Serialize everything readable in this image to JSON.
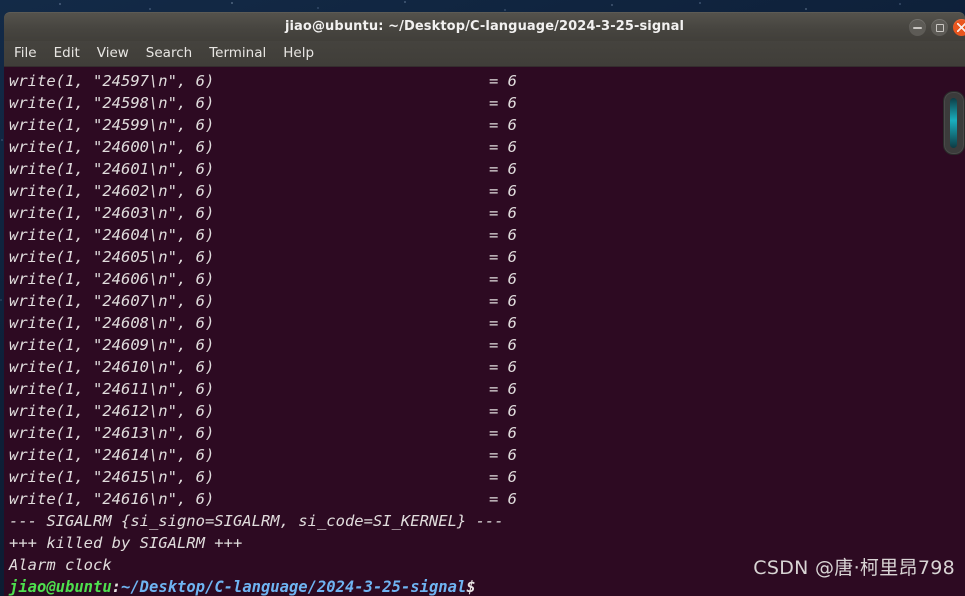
{
  "window": {
    "title": "jiao@ubuntu: ~/Desktop/C-language/2024-3-25-signal",
    "controls": {
      "minimize": "minimize",
      "maximize": "maximize",
      "close": "close"
    }
  },
  "menubar": {
    "items": [
      {
        "label": "File"
      },
      {
        "label": "Edit"
      },
      {
        "label": "View"
      },
      {
        "label": "Search"
      },
      {
        "label": "Terminal"
      },
      {
        "label": "Help"
      }
    ]
  },
  "terminal": {
    "background_color": "#2d0a22",
    "foreground_color": "#e0dcdc",
    "strace_lines": [
      {
        "call": "write(1, \"24597\\n\", 6)",
        "result": "= 6"
      },
      {
        "call": "write(1, \"24598\\n\", 6)",
        "result": "= 6"
      },
      {
        "call": "write(1, \"24599\\n\", 6)",
        "result": "= 6"
      },
      {
        "call": "write(1, \"24600\\n\", 6)",
        "result": "= 6"
      },
      {
        "call": "write(1, \"24601\\n\", 6)",
        "result": "= 6"
      },
      {
        "call": "write(1, \"24602\\n\", 6)",
        "result": "= 6"
      },
      {
        "call": "write(1, \"24603\\n\", 6)",
        "result": "= 6"
      },
      {
        "call": "write(1, \"24604\\n\", 6)",
        "result": "= 6"
      },
      {
        "call": "write(1, \"24605\\n\", 6)",
        "result": "= 6"
      },
      {
        "call": "write(1, \"24606\\n\", 6)",
        "result": "= 6"
      },
      {
        "call": "write(1, \"24607\\n\", 6)",
        "result": "= 6"
      },
      {
        "call": "write(1, \"24608\\n\", 6)",
        "result": "= 6"
      },
      {
        "call": "write(1, \"24609\\n\", 6)",
        "result": "= 6"
      },
      {
        "call": "write(1, \"24610\\n\", 6)",
        "result": "= 6"
      },
      {
        "call": "write(1, \"24611\\n\", 6)",
        "result": "= 6"
      },
      {
        "call": "write(1, \"24612\\n\", 6)",
        "result": "= 6"
      },
      {
        "call": "write(1, \"24613\\n\", 6)",
        "result": "= 6"
      },
      {
        "call": "write(1, \"24614\\n\", 6)",
        "result": "= 6"
      },
      {
        "call": "write(1, \"24615\\n\", 6)",
        "result": "= 6"
      },
      {
        "call": "write(1, \"24616\\n\", 6)",
        "result": "= 6"
      }
    ],
    "signal_lines": [
      "--- SIGALRM {si_signo=SIGALRM, si_code=SI_KERNEL} ---",
      "+++ killed by SIGALRM +++",
      "Alarm clock"
    ],
    "prompt": {
      "user_host": "jiao@ubuntu",
      "separator": ":",
      "path": "~/Desktop/C-language/2024-3-25-signal",
      "symbol": "$"
    }
  },
  "scrollbar": {
    "name": "vertical-scrollbar-thumb"
  },
  "watermark": {
    "text": "CSDN @唐·柯里昂798"
  }
}
